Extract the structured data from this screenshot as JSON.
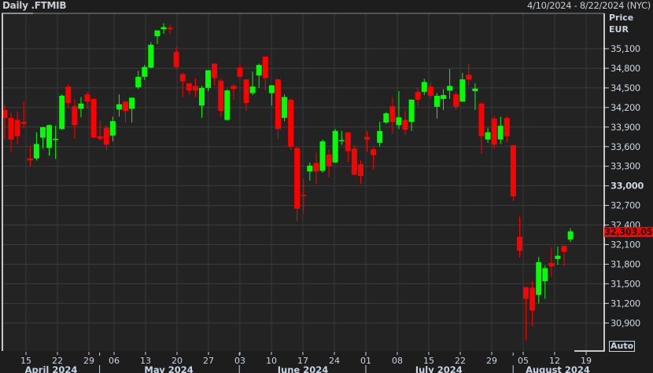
{
  "header": {
    "title": "Daily .FTMIB",
    "date_range": "4/10/2024 - 8/22/2024 (NYC)"
  },
  "axis": {
    "price_label": "Price",
    "currency_label": "EUR",
    "auto_label": "Auto",
    "last_price_label": "32,303.05"
  },
  "colors": {
    "up": "#00ff00",
    "down": "#ff0000",
    "last_price_bg": "#ff0000"
  },
  "chart_data": {
    "type": "candlestick",
    "title": "Daily .FTMIB",
    "ylabel": "Price EUR",
    "ylim": [
      30700,
      35500
    ],
    "y_ticks": [
      {
        "v": 35100,
        "label": "35,100"
      },
      {
        "v": 34800,
        "label": "34,800"
      },
      {
        "v": 34500,
        "label": "34,500"
      },
      {
        "v": 34200,
        "label": "34,200"
      },
      {
        "v": 33900,
        "label": "33,900"
      },
      {
        "v": 33600,
        "label": "33,600"
      },
      {
        "v": 33300,
        "label": "33,300"
      },
      {
        "v": 33000,
        "label": "33,000"
      },
      {
        "v": 32700,
        "label": "32,700"
      },
      {
        "v": 32400,
        "label": "32,400"
      },
      {
        "v": 32100,
        "label": "32,100"
      },
      {
        "v": 31800,
        "label": "31,800"
      },
      {
        "v": 31500,
        "label": "31,500"
      },
      {
        "v": 31200,
        "label": "31,200"
      },
      {
        "v": 30900,
        "label": "30,900"
      }
    ],
    "x_ticks": [
      {
        "i": 3,
        "label": "15"
      },
      {
        "i": 8,
        "label": "22"
      },
      {
        "i": 13,
        "label": "29"
      },
      {
        "i": 17,
        "label": "06"
      },
      {
        "i": 22,
        "label": "13"
      },
      {
        "i": 27,
        "label": "20"
      },
      {
        "i": 32,
        "label": "27"
      },
      {
        "i": 37,
        "label": "03"
      },
      {
        "i": 42,
        "label": "10"
      },
      {
        "i": 47,
        "label": "17"
      },
      {
        "i": 52,
        "label": "24"
      },
      {
        "i": 57,
        "label": "01"
      },
      {
        "i": 62,
        "label": "08"
      },
      {
        "i": 67,
        "label": "15"
      },
      {
        "i": 72,
        "label": "22"
      },
      {
        "i": 77,
        "label": "29"
      },
      {
        "i": 82,
        "label": "05"
      },
      {
        "i": 87,
        "label": "12"
      },
      {
        "i": 92,
        "label": "19"
      }
    ],
    "months": [
      {
        "label": "April 2024",
        "center": 7,
        "end": 14.7
      },
      {
        "label": "May 2024",
        "center": 25.7,
        "end": 36.9
      },
      {
        "label": "June 2024",
        "center": 47,
        "end": 57
      },
      {
        "label": "July 2024",
        "center": 68.6,
        "end": 80.4
      },
      {
        "label": "August 2024",
        "center": 87.5
      }
    ],
    "last_price": 32303.05,
    "candles": [
      [
        34160,
        34240,
        33710,
        34040
      ],
      [
        34040,
        34120,
        33520,
        33710
      ],
      [
        34010,
        34130,
        33640,
        33760
      ],
      [
        33980,
        34290,
        33880,
        33950
      ],
      [
        33420,
        33620,
        33300,
        33390
      ],
      [
        33420,
        33820,
        33390,
        33640
      ],
      [
        33740,
        33900,
        33570,
        33900
      ],
      [
        33580,
        33940,
        33460,
        33930
      ],
      [
        33700,
        33920,
        33410,
        33720
      ],
      [
        33870,
        34400,
        33860,
        34380
      ],
      [
        34520,
        34560,
        34200,
        34270
      ],
      [
        34220,
        34330,
        33720,
        33930
      ],
      [
        34180,
        34360,
        34050,
        34260
      ],
      [
        34400,
        34440,
        34180,
        34290
      ],
      [
        34330,
        34340,
        33740,
        33740
      ],
      [
        33760,
        34000,
        33690,
        33720
      ],
      [
        33890,
        33930,
        33540,
        33630
      ],
      [
        33770,
        34060,
        33680,
        33990
      ],
      [
        34170,
        34400,
        34060,
        34250
      ],
      [
        34290,
        34300,
        33970,
        34150
      ],
      [
        34180,
        34350,
        33970,
        34350
      ],
      [
        34510,
        34760,
        34480,
        34670
      ],
      [
        34670,
        34850,
        34620,
        34820
      ],
      [
        34810,
        35200,
        34800,
        35160
      ],
      [
        35290,
        35380,
        35170,
        35380
      ],
      [
        35400,
        35490,
        35330,
        35430
      ],
      [
        35420,
        35470,
        35330,
        35400
      ],
      [
        35050,
        35120,
        34800,
        34820
      ],
      [
        34710,
        34730,
        34360,
        34600
      ],
      [
        34570,
        34570,
        34400,
        34460
      ],
      [
        34530,
        34650,
        34360,
        34460
      ],
      [
        34230,
        34530,
        34040,
        34500
      ],
      [
        34500,
        34770,
        34450,
        34770
      ],
      [
        34870,
        34880,
        34530,
        34650
      ],
      [
        34610,
        34640,
        34060,
        34150
      ],
      [
        34010,
        34480,
        34000,
        34460
      ],
      [
        34530,
        34560,
        34320,
        34480
      ],
      [
        34810,
        34860,
        34620,
        34670
      ],
      [
        34630,
        34630,
        34150,
        34270
      ],
      [
        34420,
        34750,
        34390,
        34520
      ],
      [
        34690,
        34870,
        34500,
        34850
      ],
      [
        34980,
        34980,
        34460,
        34650
      ],
      [
        34420,
        34540,
        34230,
        34540
      ],
      [
        34630,
        34640,
        33710,
        33870
      ],
      [
        34040,
        34400,
        33990,
        34360
      ],
      [
        34320,
        34330,
        33550,
        33600
      ],
      [
        33580,
        33600,
        32460,
        32650
      ],
      [
        32860,
        33100,
        32580,
        32850
      ],
      [
        33220,
        33360,
        33080,
        33310
      ],
      [
        33350,
        33510,
        33030,
        33220
      ],
      [
        33230,
        33710,
        33200,
        33680
      ],
      [
        33480,
        33560,
        33130,
        33300
      ],
      [
        33360,
        33870,
        33350,
        33840
      ],
      [
        33690,
        33840,
        33630,
        33700
      ],
      [
        33820,
        33820,
        33360,
        33530
      ],
      [
        33570,
        33620,
        33160,
        33170
      ],
      [
        33330,
        33390,
        33030,
        33150
      ],
      [
        33750,
        33840,
        33520,
        33710
      ],
      [
        33560,
        33590,
        33250,
        33470
      ],
      [
        33660,
        33980,
        33600,
        33840
      ],
      [
        33970,
        34130,
        33950,
        34110
      ],
      [
        34220,
        34350,
        33800,
        33980
      ],
      [
        33930,
        34450,
        33870,
        34050
      ],
      [
        34010,
        34150,
        33780,
        33860
      ],
      [
        33980,
        34320,
        33840,
        34320
      ],
      [
        34440,
        34500,
        34220,
        34320
      ],
      [
        34440,
        34640,
        34390,
        34590
      ],
      [
        34520,
        34580,
        34340,
        34380
      ],
      [
        34210,
        34420,
        34030,
        34380
      ],
      [
        34330,
        34480,
        34160,
        34390
      ],
      [
        34460,
        34790,
        34330,
        34530
      ],
      [
        34400,
        34440,
        34170,
        34210
      ],
      [
        34290,
        34730,
        34290,
        34630
      ],
      [
        34700,
        34870,
        34530,
        34630
      ],
      [
        34450,
        34570,
        34160,
        34490
      ],
      [
        34260,
        34280,
        33490,
        33760
      ],
      [
        33710,
        33890,
        33660,
        33820
      ],
      [
        34030,
        34070,
        33570,
        33630
      ],
      [
        33710,
        34060,
        33640,
        33920
      ],
      [
        34040,
        34070,
        33660,
        33760
      ],
      [
        33620,
        33630,
        32770,
        32840
      ],
      [
        32220,
        32530,
        31900,
        32010
      ],
      [
        31450,
        31450,
        30630,
        31270
      ],
      [
        31440,
        31540,
        30850,
        31090
      ],
      [
        31330,
        31910,
        31200,
        31830
      ],
      [
        31540,
        31780,
        31270,
        31740
      ],
      [
        31820,
        32060,
        31610,
        31770
      ],
      [
        31880,
        32070,
        31790,
        31930
      ],
      [
        32080,
        32080,
        31770,
        31990
      ],
      [
        32180,
        32350,
        32140,
        32303.05
      ]
    ]
  }
}
